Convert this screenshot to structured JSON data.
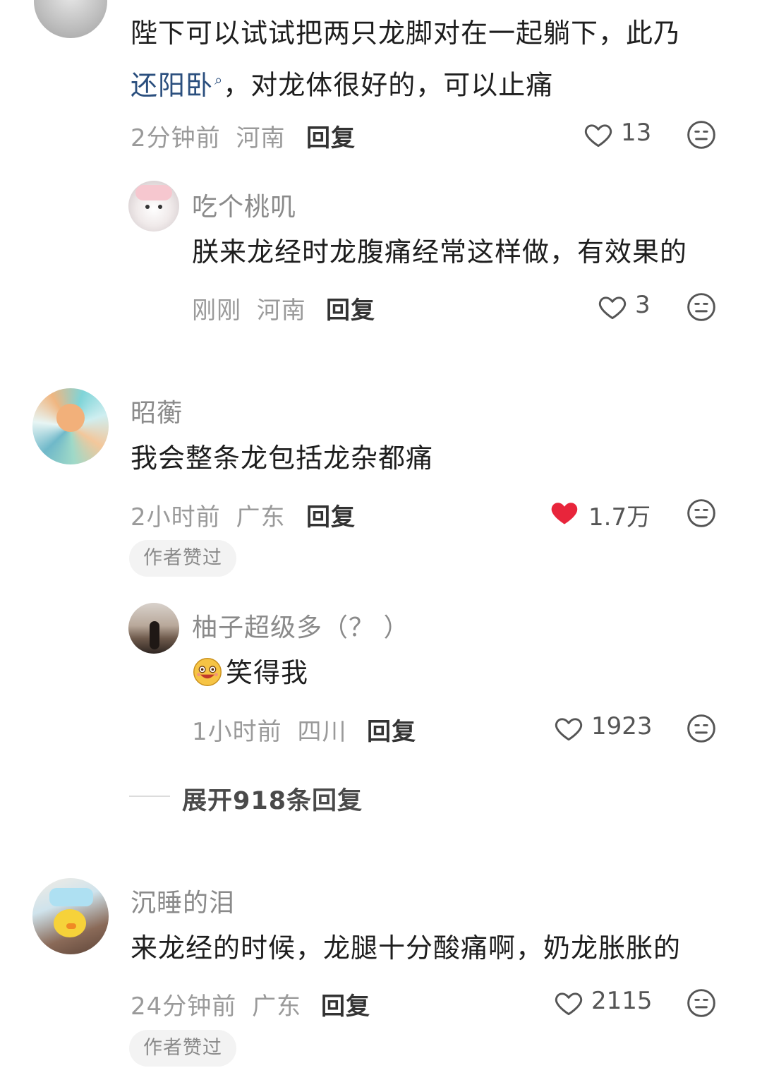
{
  "comments": [
    {
      "text_line1": "陛下可以试试把两只龙脚对在一起躺下，此乃",
      "text_link": "还阳卧",
      "text_line2_rest": "，对龙体很好的，可以止痛",
      "time": "2分钟前",
      "location": "河南",
      "reply_label": "回复",
      "likes": "13",
      "liked": false,
      "replies": [
        {
          "username": "吃个桃叽",
          "text": "朕来龙经时龙腹痛经常这样做，有效果的",
          "time": "刚刚",
          "location": "河南",
          "reply_label": "回复",
          "likes": "3",
          "liked": false
        }
      ]
    },
    {
      "username": "昭蘅",
      "text": "我会整条龙包括龙杂都痛",
      "time": "2小时前",
      "location": "广东",
      "reply_label": "回复",
      "likes": "1.7万",
      "liked": true,
      "badge": "作者赞过",
      "replies": [
        {
          "username": "柚子超级多（？ ）",
          "text": "笑得我",
          "time": "1小时前",
          "location": "四川",
          "reply_label": "回复",
          "likes": "1923",
          "liked": false
        }
      ],
      "expand_label": "展开918条回复"
    },
    {
      "username": "沉睡的泪",
      "text": "来龙经的时候，龙腿十分酸痛啊，奶龙胀胀的",
      "time": "24分钟前",
      "location": "广东",
      "reply_label": "回复",
      "likes": "2115",
      "liked": false,
      "badge": "作者赞过"
    }
  ],
  "colors": {
    "liked_heart": "#e8253b",
    "link": "#2b4f7e",
    "meta": "#9a9a9a"
  },
  "icons": {
    "like": "heart-outline-icon",
    "liked": "heart-filled-icon",
    "dislike": "neutral-face-icon",
    "emoji": "laughing-emoji-icon",
    "search": "search-icon"
  }
}
